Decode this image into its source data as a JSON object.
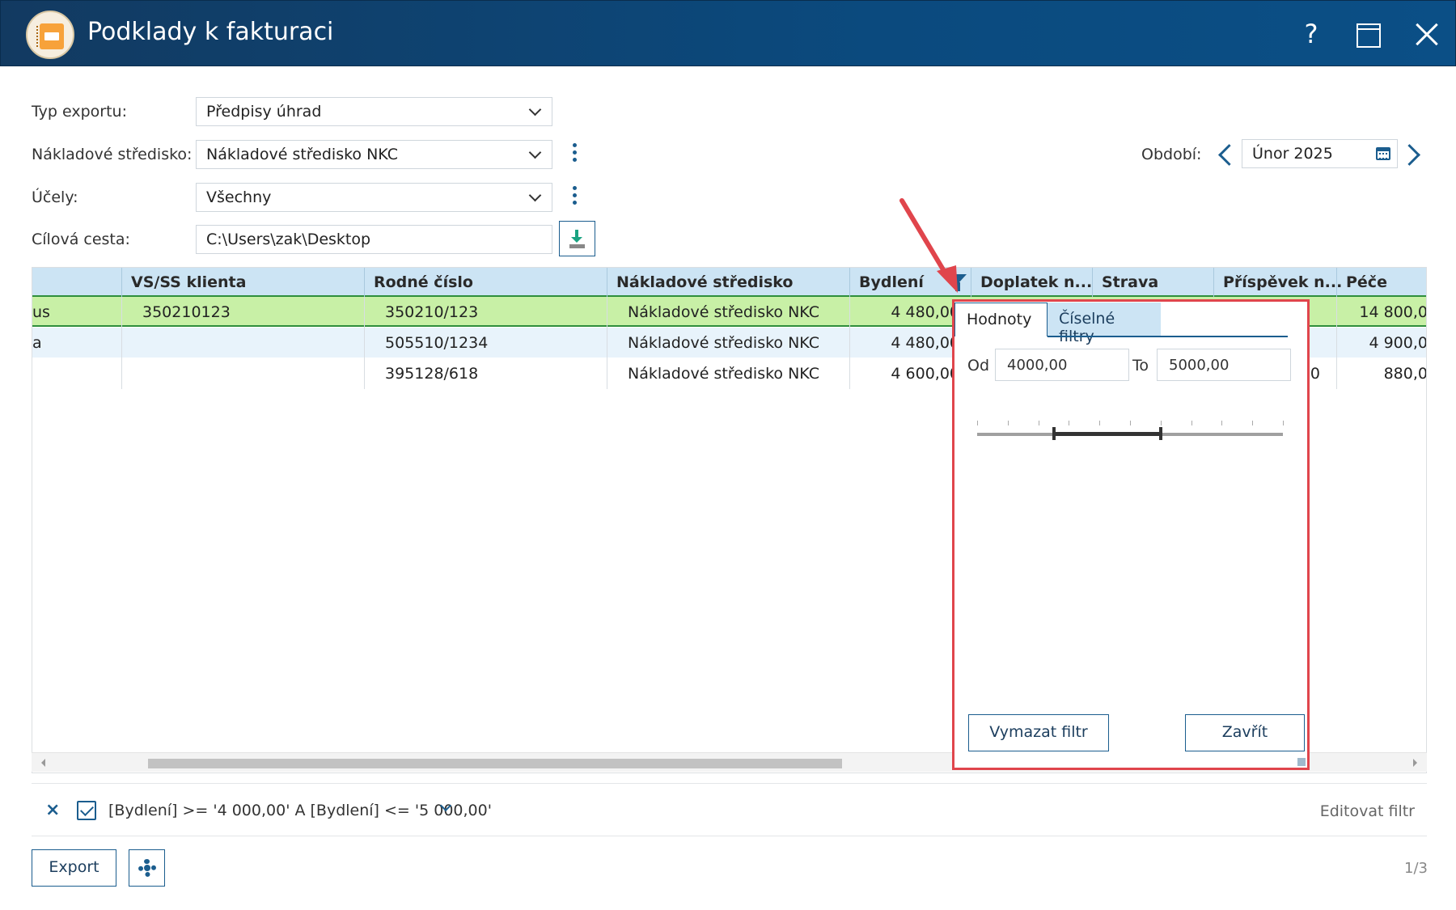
{
  "window": {
    "title": "Podklady k fakturaci",
    "help_label": "?"
  },
  "form": {
    "export_type_label": "Typ exportu:",
    "export_type_value": "Předpisy úhrad",
    "cost_center_label": "Nákladové středisko:",
    "cost_center_value": "Nákladové středisko NKC",
    "purposes_label": "Účely:",
    "purposes_value": "Všechny",
    "target_path_label": "Cílová cesta:",
    "target_path_value": "C:\\Users\\zak\\Desktop",
    "period_label": "Období:",
    "period_value": "Únor 2025"
  },
  "grid": {
    "columns": [
      "VS/SS klienta",
      "Rodné číslo",
      "Nákladové středisko",
      "Bydlení",
      "Doplatek n...",
      "Strava",
      "Příspěvek n...",
      "Péče"
    ],
    "rows": [
      {
        "first": "us",
        "vs": "350210123",
        "rc": "350210/123",
        "center": "Nákladové středisko NKC",
        "housing": "4 480,00",
        "care": "14 800,0"
      },
      {
        "first": "a",
        "vs": "",
        "rc": "505510/1234",
        "center": "Nákladové středisko NKC",
        "housing": "4 480,00",
        "care": "4 900,0"
      },
      {
        "first": "",
        "vs": "",
        "rc": "395128/618",
        "center": "Nákladové středisko NKC",
        "housing": "4 600,00",
        "contribution_tail": "0",
        "care": "880,0"
      }
    ]
  },
  "filter_popup": {
    "tab_values": "Hodnoty",
    "tab_numeric": "Číselné filtry",
    "from_label": "Od",
    "from_value": "4000,00",
    "to_label": "To",
    "to_value": "5000,00",
    "clear_button": "Vymazat filtr",
    "close_button": "Zavřít",
    "range_min_fraction": 0.25,
    "range_max_fraction": 0.6
  },
  "filter_bar": {
    "remove_label": "×",
    "expression": "[Bydlení] >= '4 000,00' A [Bydlení] <= '5 000,00'",
    "edit_label": "Editovat filtr"
  },
  "footer": {
    "export_button": "Export",
    "page_count": "1/3"
  },
  "colors": {
    "titlebar": "#0b4a7e",
    "header_bg": "#cce4f4",
    "selected_row": "#c8f0a6",
    "highlight_border": "#e0454c",
    "accent": "#1b5d8e"
  }
}
